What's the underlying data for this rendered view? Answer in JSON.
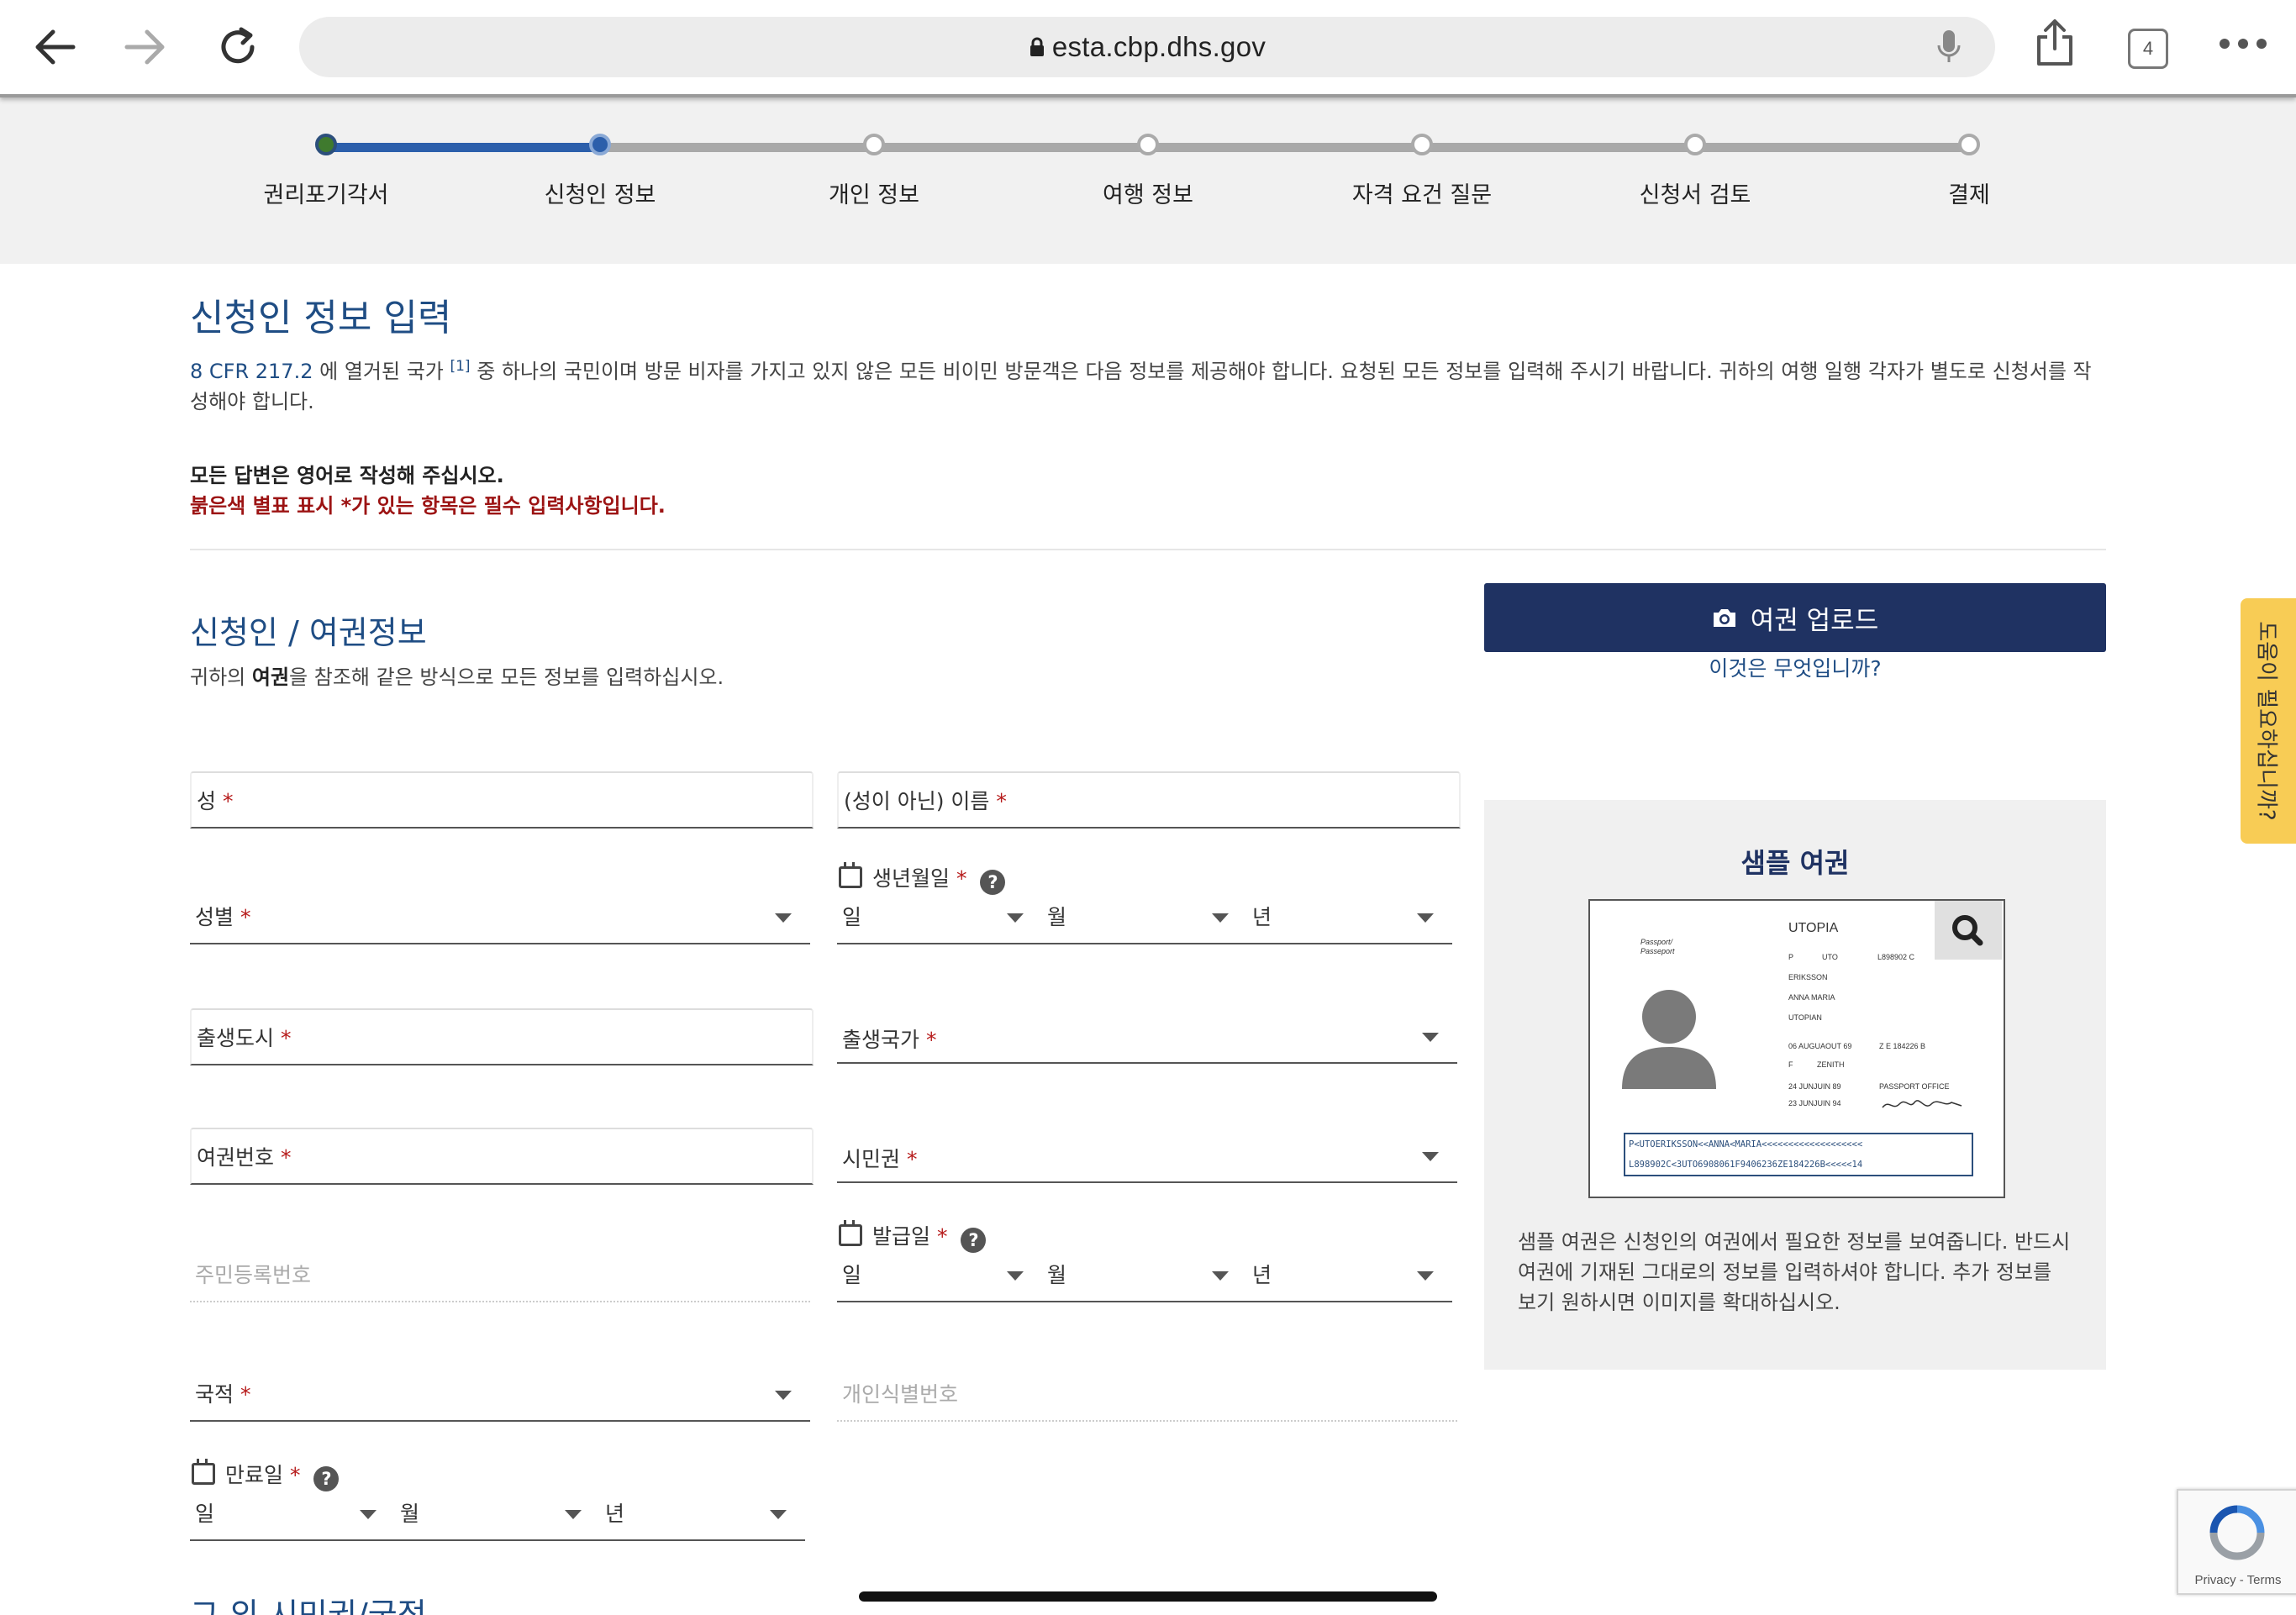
{
  "browser": {
    "url": "esta.cbp.dhs.gov",
    "tab_count": "4"
  },
  "progress": {
    "steps": [
      "권리포기각서",
      "신청인 정보",
      "개인 정보",
      "여행 정보",
      "자격 요건 질문",
      "신청서 검토",
      "결제"
    ],
    "current_step": 2
  },
  "page": {
    "title": "신청인 정보 입력",
    "intro_link": "8 CFR 217.2",
    "intro_mid": " 에 열거된 국가 ",
    "intro_footnote": "[1]",
    "intro_text": " 중 하나의 국민이며 방문 비자를 가지고 있지 않은 모든 비이민 방문객은 다음 정보를 제공해야 합니다. 요청된 모든 정보를 입력해 주시기 바랍니다. 귀하의 여행 일행 각자가 별도로 신청서를 작성해야 합니다.",
    "english_note": "모든 답변은 영어로 작성해 주십시오.",
    "required_note": "붉은색 별표 표시 *가 있는 항목은 필수 입력사항입니다."
  },
  "section": {
    "title": "신청인 / 여권정보",
    "desc_before": "귀하의 ",
    "desc_bold": "여권",
    "desc_after": "을 참조해 같은 방식으로 모든 정보를 입력하십시오.",
    "next_section_partial": "그 외 시민권/국적"
  },
  "fields": {
    "surname": "성",
    "given_name": "(성이 아닌) 이름",
    "gender": "성별",
    "dob": "생년월일",
    "birth_city": "출생도시",
    "birth_country": "출생국가",
    "passport_number": "여권번호",
    "citizenship": "시민권",
    "national_id": "주민등록번호",
    "issue_date": "발급일",
    "nationality": "국적",
    "personal_id": "개인식별번호",
    "expiry_date": "만료일",
    "required_mark": "*",
    "day": "일",
    "month": "월",
    "year": "년"
  },
  "upload": {
    "button": "여권 업로드",
    "what_is_this": "이것은 무엇입니까?"
  },
  "sample": {
    "title": "샘플 여권",
    "description": "샘플 여권은 신청인의 여권에서 필요한 정보를 보여줍니다. 반드시 여권에 기재된 그대로의 정보를 입력하셔야 합니다. 추가 정보를 보기 원하시면 이미지를 확대하십시오.",
    "passport": {
      "country": "UTOPIA",
      "label": "Passport/ Passeport",
      "type": "P",
      "code": "UTO",
      "number": "L898902 C",
      "surname": "ERIKSSON",
      "given": "ANNA MARIA",
      "nationality": "UTOPIAN",
      "dob": "06 AUGUAOUT 69",
      "personal_no": "Z E 184226 B",
      "sex": "F",
      "place_of_birth": "ZENITH",
      "issue": "24 JUNJUIN 89",
      "authority": "PASSPORT OFFICE",
      "expiry": "23 JUNJUIN 94",
      "mrz1": "P<UTOERIKSSON<<ANNA<MARIA<<<<<<<<<<<<<<<<<<<",
      "mrz2": "L898902C<3UTO6908061F9406236ZE184226B<<<<<14"
    }
  },
  "help_tab": "도움이 필요하십니까?",
  "recaptcha": {
    "text": "Privacy - Terms"
  },
  "colors": {
    "primary_blue": "#1f4d84",
    "dark_navy": "#1f3262",
    "required_red": "#9c1313",
    "help_yellow": "#f8cc55"
  }
}
